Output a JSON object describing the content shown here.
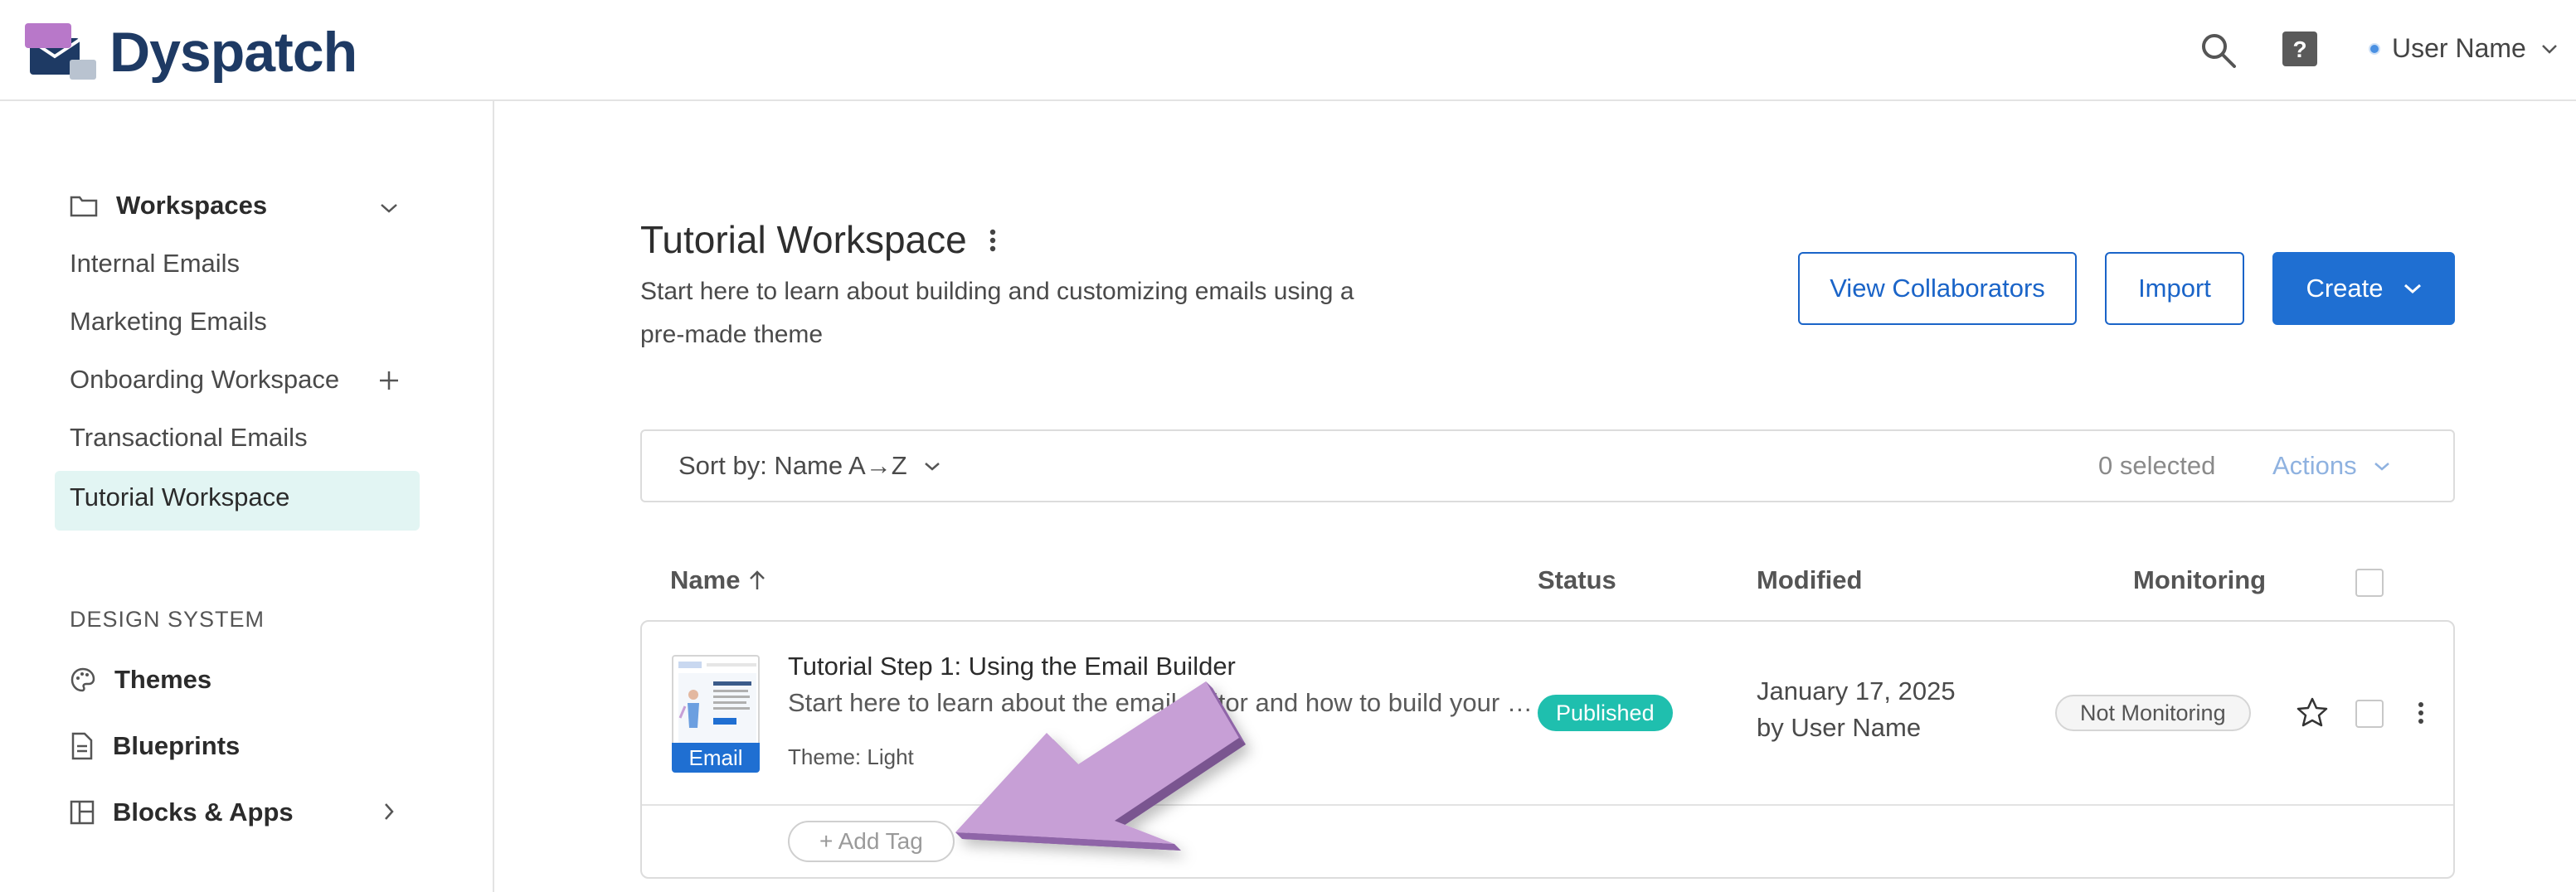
{
  "header": {
    "brand": "Dyspatch",
    "search_icon": "search-icon",
    "help_icon": "help-icon",
    "user_name": "User Name"
  },
  "sidebar": {
    "workspaces_label": "Workspaces",
    "items": [
      {
        "label": "Internal Emails"
      },
      {
        "label": "Marketing Emails"
      },
      {
        "label": "Onboarding Workspace"
      },
      {
        "label": "Transactional Emails"
      },
      {
        "label": "Tutorial Workspace",
        "active": true
      }
    ],
    "section_title": "DESIGN SYSTEM",
    "design_items": [
      {
        "label": "Themes",
        "icon": "palette-icon"
      },
      {
        "label": "Blueprints",
        "icon": "document-icon"
      },
      {
        "label": "Blocks & Apps",
        "icon": "blocks-icon"
      }
    ]
  },
  "workspace": {
    "title": "Tutorial Workspace",
    "description": "Start here to learn about building and customizing emails using a pre-made theme",
    "buttons": {
      "view_collaborators": "View Collaborators",
      "import": "Import",
      "create": "Create"
    }
  },
  "toolbar": {
    "sort_label": "Sort by: Name A→Z",
    "selected_count": "0 selected",
    "actions_label": "Actions"
  },
  "table": {
    "columns": {
      "name": "Name",
      "status": "Status",
      "modified": "Modified",
      "monitoring": "Monitoring"
    },
    "rows": [
      {
        "title": "Tutorial Step 1: Using the Email Builder",
        "description": "Start here to learn about the email editor and how to build your e…",
        "theme": "Theme: Light",
        "type_badge": "Email",
        "status": "Published",
        "modified_date": "January 17, 2025",
        "modified_by": "by User Name",
        "monitoring": "Not Monitoring",
        "add_tag": "+ Add Tag"
      }
    ]
  },
  "colors": {
    "brand_navy": "#1e3a64",
    "primary_blue": "#1f6fd2",
    "published_teal": "#1fbfae",
    "active_bg": "#e2f5f3",
    "annotation_purple": "#c79fd6"
  }
}
